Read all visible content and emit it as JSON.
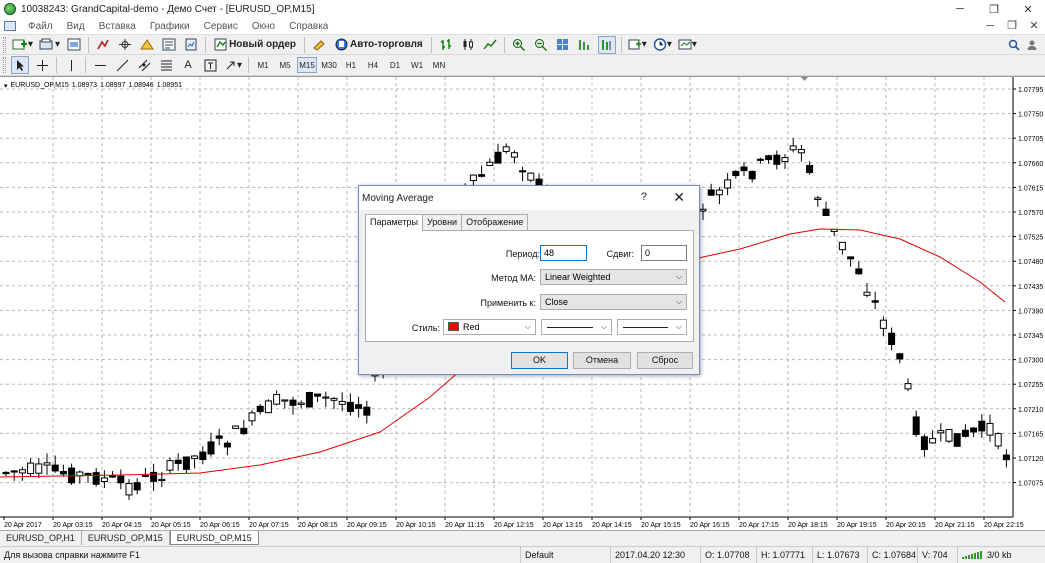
{
  "window": {
    "title": "10038243: GrandCapital-demo - Демо Счет - [EURUSD_OP,M15]"
  },
  "menu": [
    "Файл",
    "Вид",
    "Вставка",
    "Графики",
    "Сервис",
    "Окно",
    "Справка"
  ],
  "toolbar": {
    "new_order": "Новый ордер",
    "auto_trading": "Авто-торговля"
  },
  "timeframes": [
    "M1",
    "M5",
    "M15",
    "M30",
    "H1",
    "H4",
    "D1",
    "W1",
    "MN"
  ],
  "active_timeframe": "M15",
  "chart": {
    "symbol": "EURUSD_OP,M15",
    "ohlc": [
      "1.08973",
      "1.08997",
      "1.08946",
      "1.08951"
    ],
    "price_labels": [
      "1.07795",
      "1.07750",
      "1.07705",
      "1.07660",
      "1.07615",
      "1.07570",
      "1.07525",
      "1.07480",
      "1.07435",
      "1.07390",
      "1.07345",
      "1.07300",
      "1.07255",
      "1.07210",
      "1.07165",
      "1.07120",
      "1.07075"
    ],
    "time_labels": [
      "20 Apr 2017",
      "20 Apr 03:15",
      "20 Apr 04:15",
      "20 Apr 05:15",
      "20 Apr 06:15",
      "20 Apr 07:15",
      "20 Apr 08:15",
      "20 Apr 09:15",
      "20 Apr 10:15",
      "20 Apr 11:15",
      "20 Apr 12:15",
      "20 Apr 13:15",
      "20 Apr 14:15",
      "20 Apr 15:15",
      "20 Apr 16:15",
      "20 Apr 17:15",
      "20 Apr 18:15",
      "20 Apr 19:15",
      "20 Apr 20:15",
      "20 Apr 21:15",
      "20 Apr 22:15"
    ],
    "ma_color": "#e00000",
    "bull_color": "#ffffff",
    "bear_color": "#000000"
  },
  "chart_tabs": [
    "EURUSD_OP,H1",
    "EURUSD_OP,M15",
    "EURUSD_OP,M15"
  ],
  "active_chart_tab": 2,
  "dialog": {
    "title": "Moving Average",
    "help": "?",
    "close": "✕",
    "tabs": [
      "Параметры",
      "Уровни",
      "Отображение"
    ],
    "period_label": "Период:",
    "period_value": "48",
    "shift_label": "Сдвиг:",
    "shift_value": "0",
    "method_label": "Метод МА:",
    "method_value": "Linear Weighted",
    "apply_label": "Применить к:",
    "apply_value": "Close",
    "style_label": "Стиль:",
    "style_color_name": "Red",
    "style_color": "#ff0000",
    "ok": "OK",
    "cancel": "Отмена",
    "reset": "Сброс"
  },
  "status": {
    "help": "Для вызова справки нажмите F1",
    "profile": "Default",
    "datetime": "2017.04.20 12:30",
    "open": "O: 1.07708",
    "high": "H: 1.07771",
    "low": "L: 1.07673",
    "close": "C: 1.07684",
    "volume": "V: 704",
    "traffic": "3/0 kb"
  }
}
